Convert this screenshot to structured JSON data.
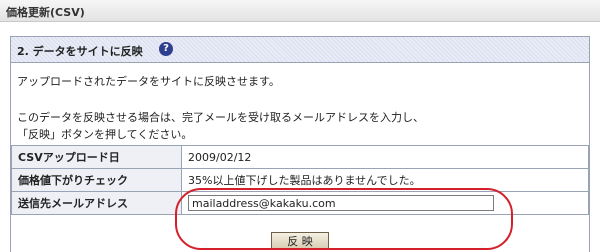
{
  "header": {
    "title": "価格更新(CSV)"
  },
  "section": {
    "title": "2. データをサイトに反映",
    "help_icon": "question-circle-icon",
    "help_icon_glyph": "?",
    "description_line1": "アップロードされたデータをサイトに反映させます。",
    "description_line2": "このデータを反映させる場合は、完了メールを受け取るメールアドレスを入力し、",
    "description_line3": "「反映」ボタンを押してください。"
  },
  "info": {
    "upload_label": "CSVアップロード日",
    "upload_date": "2009/02/12",
    "price_check_label": "価格値下がりチェック",
    "price_check_result": "35%以上値下げした製品はありませんでした。",
    "email_label": "送信先メールアドレス",
    "email_value": "mailaddress@kakaku.com"
  },
  "actions": {
    "submit_label": "反 映"
  },
  "colors": {
    "highlight": "#d4202a",
    "help_icon": "#2f3f8f",
    "border": "#9aa3b5"
  }
}
